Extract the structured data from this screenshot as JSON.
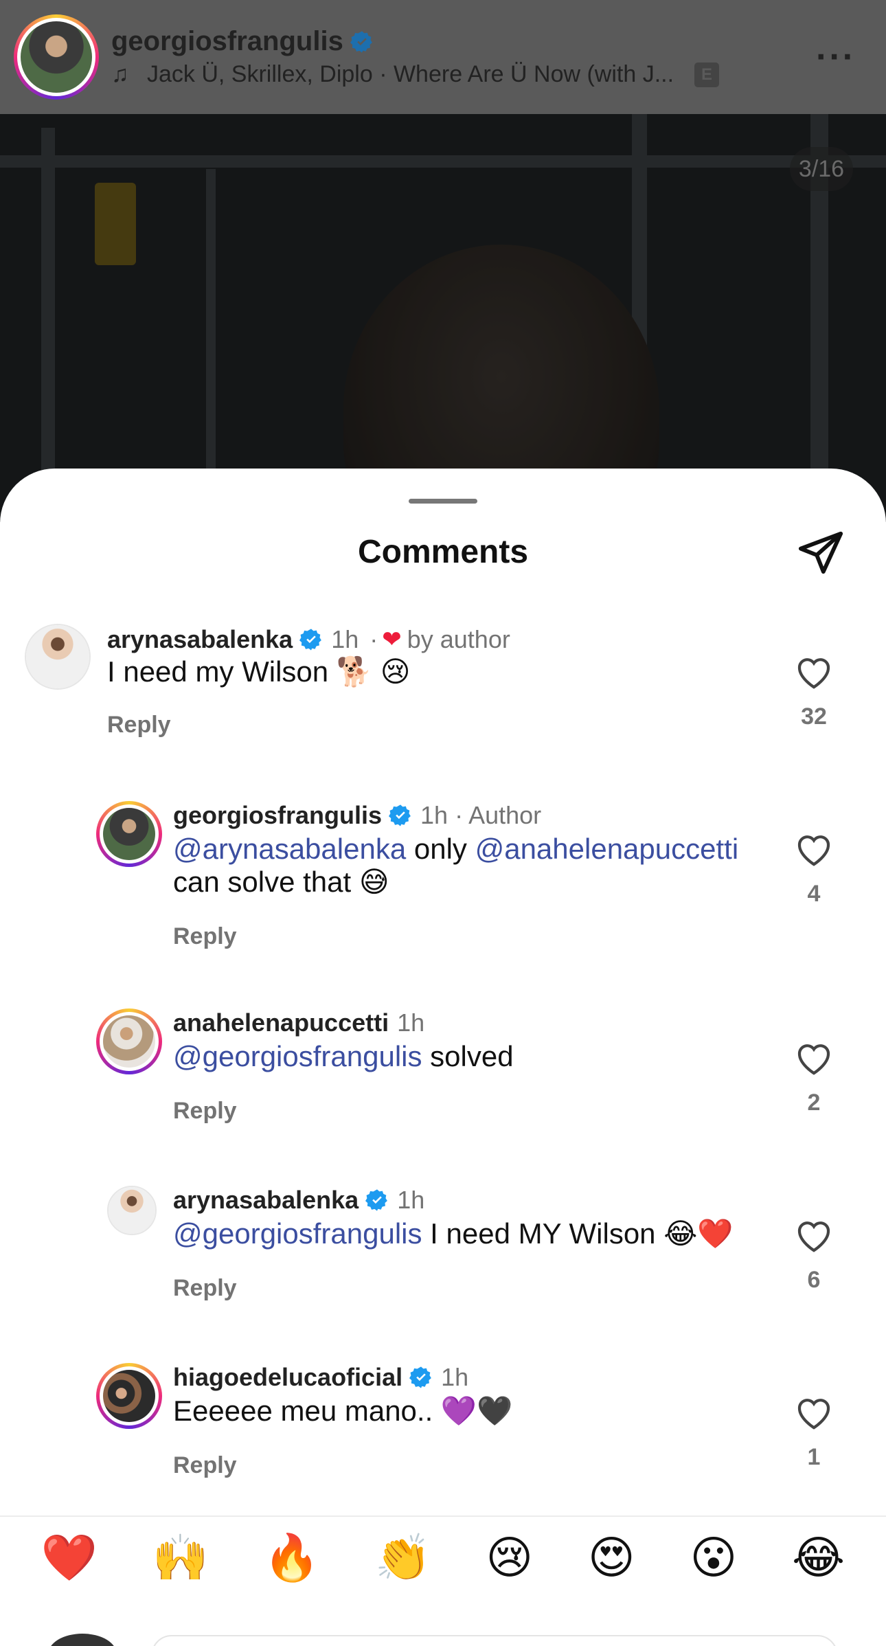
{
  "post": {
    "username": "georgiosfrangulis",
    "music": "Jack Ü, Skrillex, Diplo · Where Are Ü Now (with J...",
    "explicit_badge": "E",
    "image_counter": "3/16",
    "more_icon": "more-dots-icon"
  },
  "sheet": {
    "title": "Comments",
    "share_icon": "send-paper-plane-icon"
  },
  "comments": [
    {
      "username": "arynasabalenka",
      "verified": true,
      "time": "1h",
      "extra_sep": "·",
      "extra": "by author",
      "text": "I need my Wilson 🐕 😢",
      "reply": "Reply",
      "likes": "32"
    },
    {
      "username": "georgiosfrangulis",
      "verified": true,
      "time": "1h",
      "extra": "· Author",
      "mention1": "@arynasabalenka",
      "text_mid": " only ",
      "mention2": "@anahelenapuccetti",
      "text_line2": "can solve that 😅",
      "reply": "Reply",
      "likes": "4"
    },
    {
      "username": "anahelenapuccetti",
      "verified": false,
      "time": "1h",
      "mention1": "@georgiosfrangulis",
      "text_after": " solved",
      "reply": "Reply",
      "likes": "2"
    },
    {
      "username": "arynasabalenka",
      "verified": true,
      "time": "1h",
      "mention1": "@georgiosfrangulis",
      "text_after": " I need MY Wilson 😂❤️",
      "reply": "Reply",
      "likes": "6"
    },
    {
      "username": "hiagoedelucaoficial",
      "verified": true,
      "time": "1h",
      "text": "Eeeeee meu mano.. 💜🖤",
      "reply": "Reply",
      "likes": "1"
    }
  ],
  "emoji_bar": [
    "❤️",
    "🙌",
    "🔥",
    "👏",
    "😢",
    "😍",
    "😮",
    "😂"
  ],
  "colors": {
    "verified_blue": "#1d9bf0",
    "mention": "#3b4ea0",
    "heart_red": "#ed1c3a"
  }
}
